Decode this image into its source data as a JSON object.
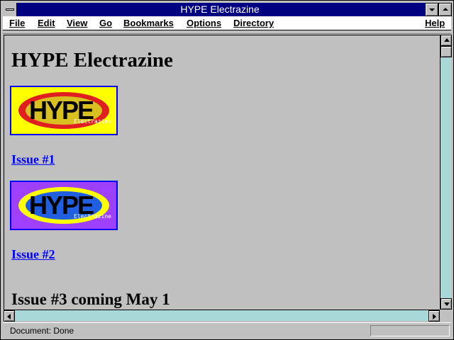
{
  "window": {
    "title": "HYPE Electrazine"
  },
  "menu": [
    {
      "label": "File"
    },
    {
      "label": "Edit"
    },
    {
      "label": "View"
    },
    {
      "label": "Go"
    },
    {
      "label": "Bookmarks"
    },
    {
      "label": "Options"
    },
    {
      "label": "Directory"
    },
    {
      "label": "Help"
    }
  ],
  "page": {
    "heading": "HYPE Electrazine",
    "logos": [
      {
        "text": "HYPE",
        "sub": "Electrazine",
        "background": "#ffff00",
        "ring": "#e02020",
        "fill": "#d8c020"
      },
      {
        "text": "HYPE",
        "sub": "Electrazine",
        "background": "#a040ff",
        "ring": "#ffff00",
        "fill": "#2060e0"
      }
    ],
    "links": [
      {
        "label": "Issue #1"
      },
      {
        "label": "Issue #2"
      }
    ],
    "coming": "Issue #3 coming May 1"
  },
  "status": {
    "text": "Document: Done"
  },
  "colors": {
    "titlebar": "#000080",
    "link": "#0000ff",
    "scroll_track": "#a8d8d8"
  }
}
